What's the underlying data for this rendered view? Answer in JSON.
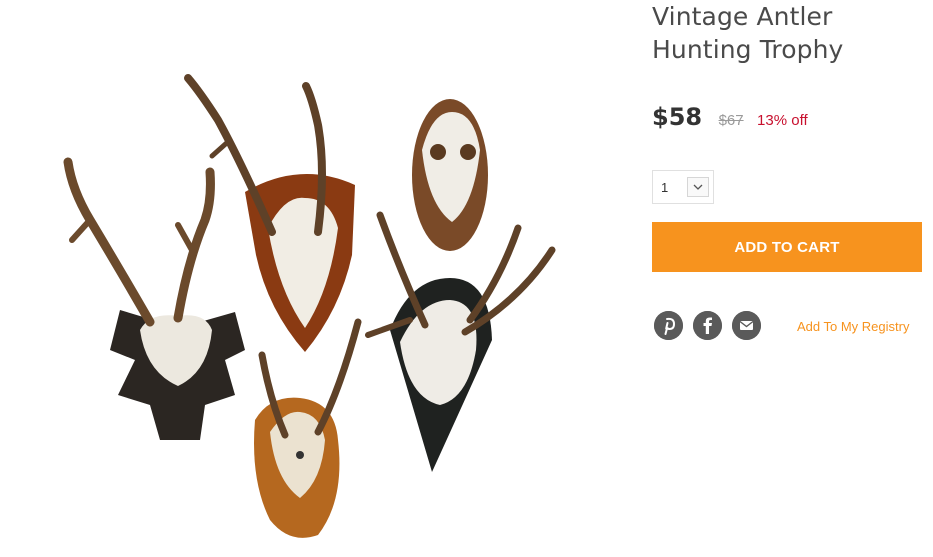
{
  "product": {
    "title_line1": "Vintage Antler",
    "title_line2": "Hunting Trophy",
    "price": "$58",
    "original_price": "$67",
    "discount": "13% off"
  },
  "quantity": {
    "value": "1"
  },
  "actions": {
    "add_to_cart": "ADD TO CART",
    "registry_link": "Add To My Registry"
  },
  "icons": [
    "pinterest-icon",
    "facebook-icon",
    "email-icon",
    "chevron-down-icon"
  ],
  "colors": {
    "accent": "#f7931e",
    "discount": "#c8102e",
    "social_icon": "#5a5a5a",
    "title": "#4a4a4a"
  }
}
